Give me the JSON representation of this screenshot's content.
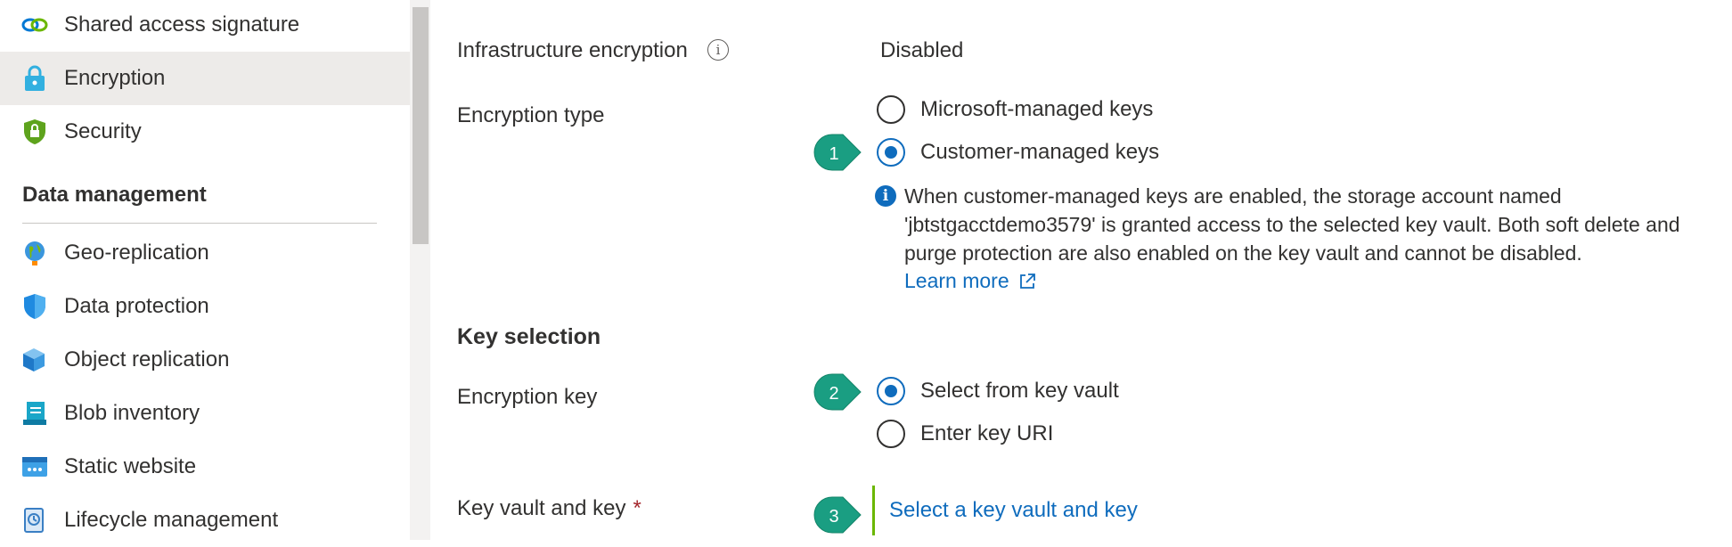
{
  "sidebar": {
    "items": [
      {
        "label": "Shared access signature",
        "icon": "link-chain-icon",
        "selected": false
      },
      {
        "label": "Encryption",
        "icon": "lock-icon",
        "selected": true
      },
      {
        "label": "Security",
        "icon": "shield-lock-icon",
        "selected": false
      }
    ],
    "section_header": "Data management",
    "data_items": [
      {
        "label": "Geo-replication",
        "icon": "globe-icon"
      },
      {
        "label": "Data protection",
        "icon": "shield-icon"
      },
      {
        "label": "Object replication",
        "icon": "cubes-icon"
      },
      {
        "label": "Blob inventory",
        "icon": "inventory-icon"
      },
      {
        "label": "Static website",
        "icon": "website-icon"
      },
      {
        "label": "Lifecycle management",
        "icon": "lifecycle-icon"
      }
    ]
  },
  "form": {
    "infra_label": "Infrastructure encryption",
    "infra_info_glyph": "i",
    "infra_value": "Disabled",
    "enc_type_label": "Encryption type",
    "enc_type_options": [
      "Microsoft-managed keys",
      "Customer-managed keys"
    ],
    "enc_type_selected": "Customer-managed keys",
    "info_glyph": "i",
    "info_message": "When customer-managed keys are enabled, the storage account named 'jbtstgacctdemo3579' is granted access to the selected key vault. Both soft delete and purge protection are also enabled on the key vault and cannot be disabled.",
    "learn_more": "Learn more",
    "key_selection_heading": "Key selection",
    "enc_key_label": "Encryption key",
    "enc_key_options": [
      "Select from key vault",
      "Enter key URI"
    ],
    "enc_key_selected": "Select from key vault",
    "vault_label": "Key vault and key",
    "required_marker": "*",
    "vault_link": "Select a key vault and key"
  },
  "callouts": [
    "1",
    "2",
    "3"
  ],
  "colors": {
    "accent": "#0f6cbd",
    "selected_bg": "#edebe9",
    "callout": "#1a9e82",
    "required": "#a4262c",
    "vault_border": "#6bb700"
  }
}
